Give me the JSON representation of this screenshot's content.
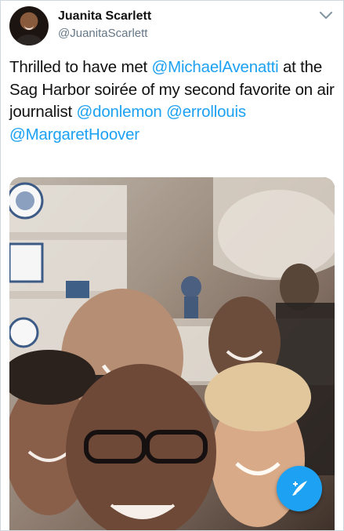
{
  "tweet": {
    "author_name": "Juanita Scarlett",
    "author_handle": "@JuanitaScarlett",
    "text_parts": [
      {
        "t": "Thrilled to have met ",
        "mention": false
      },
      {
        "t": "@MichaelAvenatti",
        "mention": true
      },
      {
        "t": " at the Sag Harbor soirée of my second favorite on air journalist ",
        "mention": false
      },
      {
        "t": "@donlemon",
        "mention": true
      },
      {
        "t": " ",
        "mention": false
      },
      {
        "t": "@errollouis",
        "mention": true
      },
      {
        "t": " ",
        "mention": false
      },
      {
        "t": "@MargaretHoover",
        "mention": true
      }
    ]
  },
  "colors": {
    "accent": "#1da1f2"
  },
  "icons": {
    "menu": "chevron-down-icon",
    "compose": "compose-tweet-icon"
  }
}
